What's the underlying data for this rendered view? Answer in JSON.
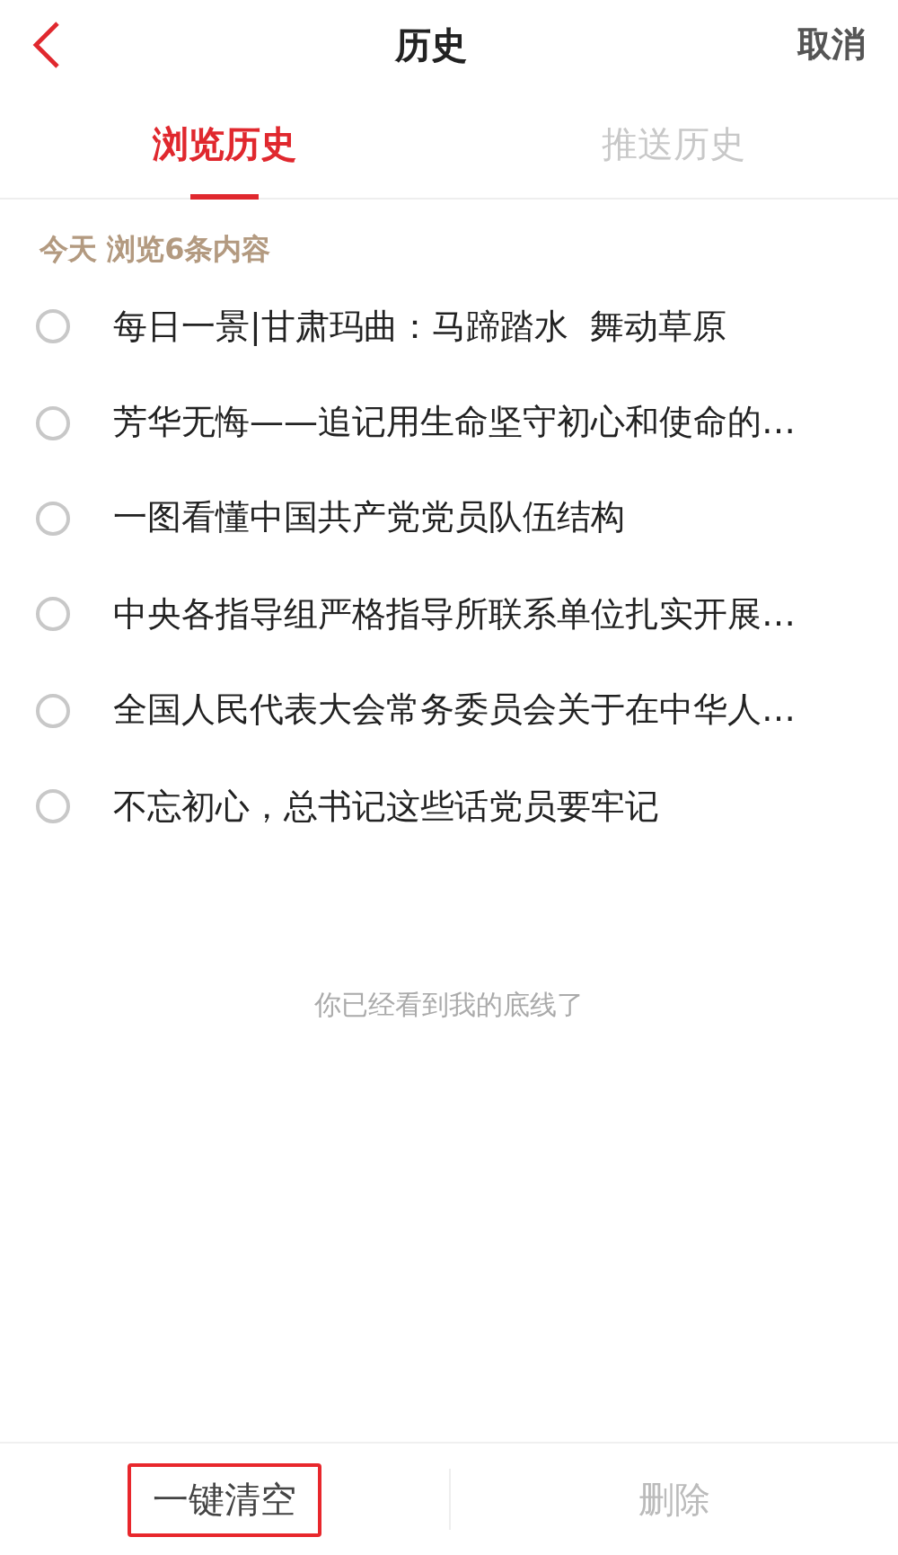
{
  "header": {
    "title": "历史",
    "cancel": "取消"
  },
  "tabs": [
    {
      "label": "浏览历史",
      "selected": true
    },
    {
      "label": "推送历史",
      "selected": false
    }
  ],
  "section": {
    "heading": "今天 浏览6条内容"
  },
  "items": [
    {
      "title": "每日一景|甘肃玛曲：马蹄踏水  舞动草原",
      "checked": false
    },
    {
      "title": "芳华无悔——追记用生命坚守初心和使命的…",
      "checked": false
    },
    {
      "title": "一图看懂中国共产党党员队伍结构",
      "checked": false
    },
    {
      "title": "中央各指导组严格指导所联系单位扎实开展…",
      "checked": false
    },
    {
      "title": "全国人民代表大会常务委员会关于在中华人…",
      "checked": false
    },
    {
      "title": "不忘初心，总书记这些话党员要牢记",
      "checked": false
    }
  ],
  "end_note": "你已经看到我的底线了",
  "actions": [
    {
      "label": "一键清空",
      "disabled": false,
      "highlighted": true
    },
    {
      "label": "删除",
      "disabled": true,
      "highlighted": false
    }
  ]
}
